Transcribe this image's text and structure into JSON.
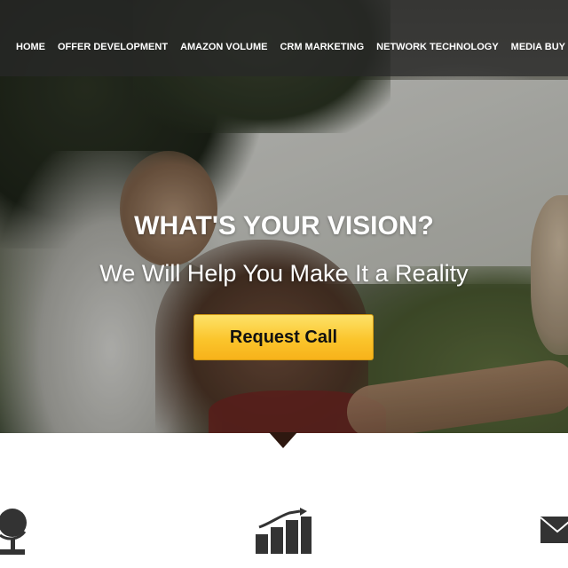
{
  "nav": {
    "items": [
      {
        "label": "HOME"
      },
      {
        "label": "OFFER DEVELOPMENT"
      },
      {
        "label": "AMAZON VOLUME"
      },
      {
        "label": "CRM MARKETING"
      },
      {
        "label": "NETWORK TECHNOLOGY"
      },
      {
        "label": "MEDIA BUY"
      }
    ]
  },
  "hero": {
    "headline": "WHAT'S YOUR VISION?",
    "subheadline": "We Will Help You Make It a Reality",
    "cta_label": "Request Call"
  },
  "features": {
    "icons": [
      "globe-icon",
      "bar-chart-icon",
      "envelope-icon"
    ]
  },
  "colors": {
    "nav_background": "#282828",
    "cta_yellow": "#fbc52c",
    "icon_gray": "#333333"
  }
}
